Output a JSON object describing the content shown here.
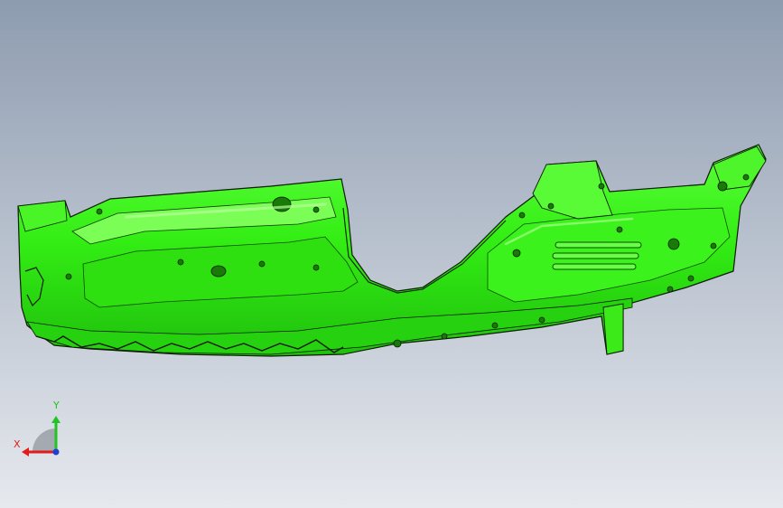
{
  "viewport": {
    "background_top": "#8e9cb0",
    "background_bottom": "#e6e9ee"
  },
  "model": {
    "part_color": "#33ee14",
    "edge_color": "#0d1a06",
    "highlight_color": "#b8ff9a"
  },
  "triad": {
    "x_label": "X",
    "y_label": "Y",
    "x_color": "#e21b1b",
    "y_color": "#21c421",
    "z_color": "#1f3fd6"
  }
}
